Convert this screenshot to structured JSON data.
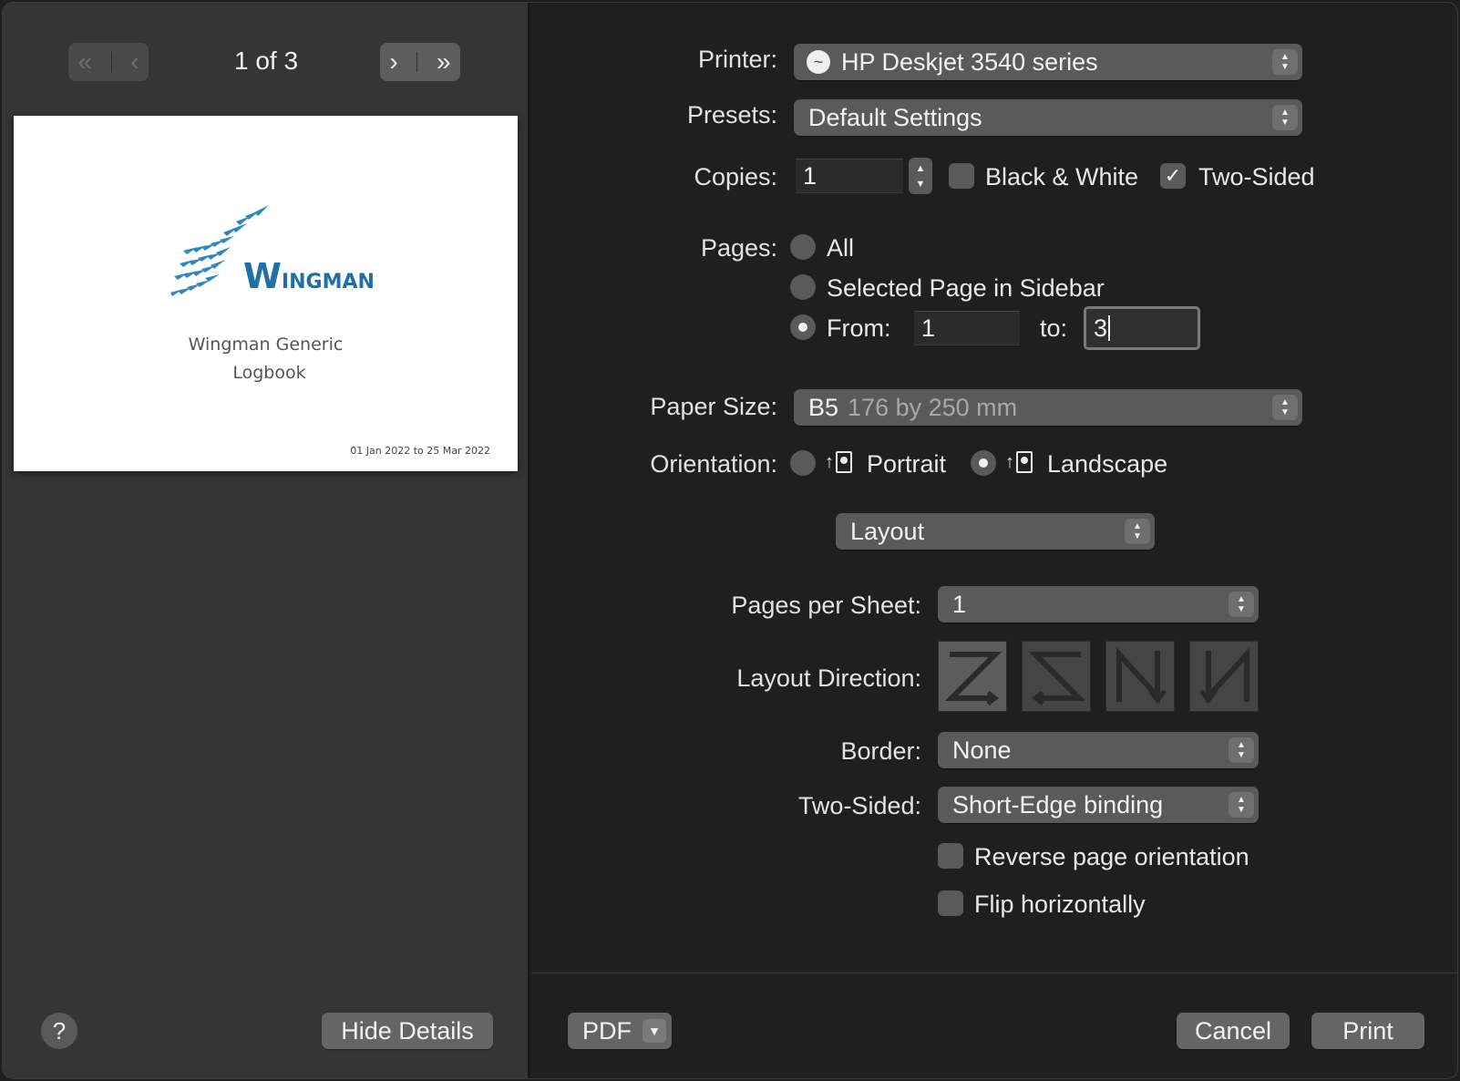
{
  "sidebar": {
    "page_counter": "1 of 3",
    "preview": {
      "logo_first": "W",
      "logo_rest": "INGMAN",
      "title_line1": "Wingman Generic",
      "title_line2": "Logbook",
      "date_range": "01 Jan 2022 to 25 Mar 2022"
    },
    "help_label": "?",
    "hide_details_label": "Hide Details"
  },
  "form": {
    "printer_label": "Printer:",
    "printer_value": "HP Deskjet 3540 series",
    "presets_label": "Presets:",
    "presets_value": "Default Settings",
    "copies_label": "Copies:",
    "copies_value": "1",
    "bw_label": "Black & White",
    "bw_checked": false,
    "two_sided_label": "Two-Sided",
    "two_sided_checked": true,
    "pages_label": "Pages:",
    "pages_all": "All",
    "pages_selected": "Selected Page in Sidebar",
    "pages_from_label": "From:",
    "pages_from_value": "1",
    "pages_to_label": "to:",
    "pages_to_value": "3",
    "paper_size_label": "Paper Size:",
    "paper_size_name": "B5",
    "paper_size_dims": "176 by 250 mm",
    "orientation_label": "Orientation:",
    "orientation_portrait": "Portrait",
    "orientation_landscape": "Landscape",
    "section_value": "Layout",
    "pages_per_sheet_label": "Pages per Sheet:",
    "pages_per_sheet_value": "1",
    "layout_direction_label": "Layout Direction:",
    "border_label": "Border:",
    "border_value": "None",
    "two_sided_option_label": "Two-Sided:",
    "two_sided_option_value": "Short-Edge binding",
    "reverse_label": "Reverse page orientation",
    "flip_label": "Flip horizontally"
  },
  "footer": {
    "pdf_label": "PDF",
    "cancel_label": "Cancel",
    "print_label": "Print"
  },
  "colors": {
    "window_bg": "#1f1f1f",
    "sidebar_bg": "#353535",
    "control_bg": "#5a5a5a",
    "logo_blue": "#1f6fa8"
  }
}
